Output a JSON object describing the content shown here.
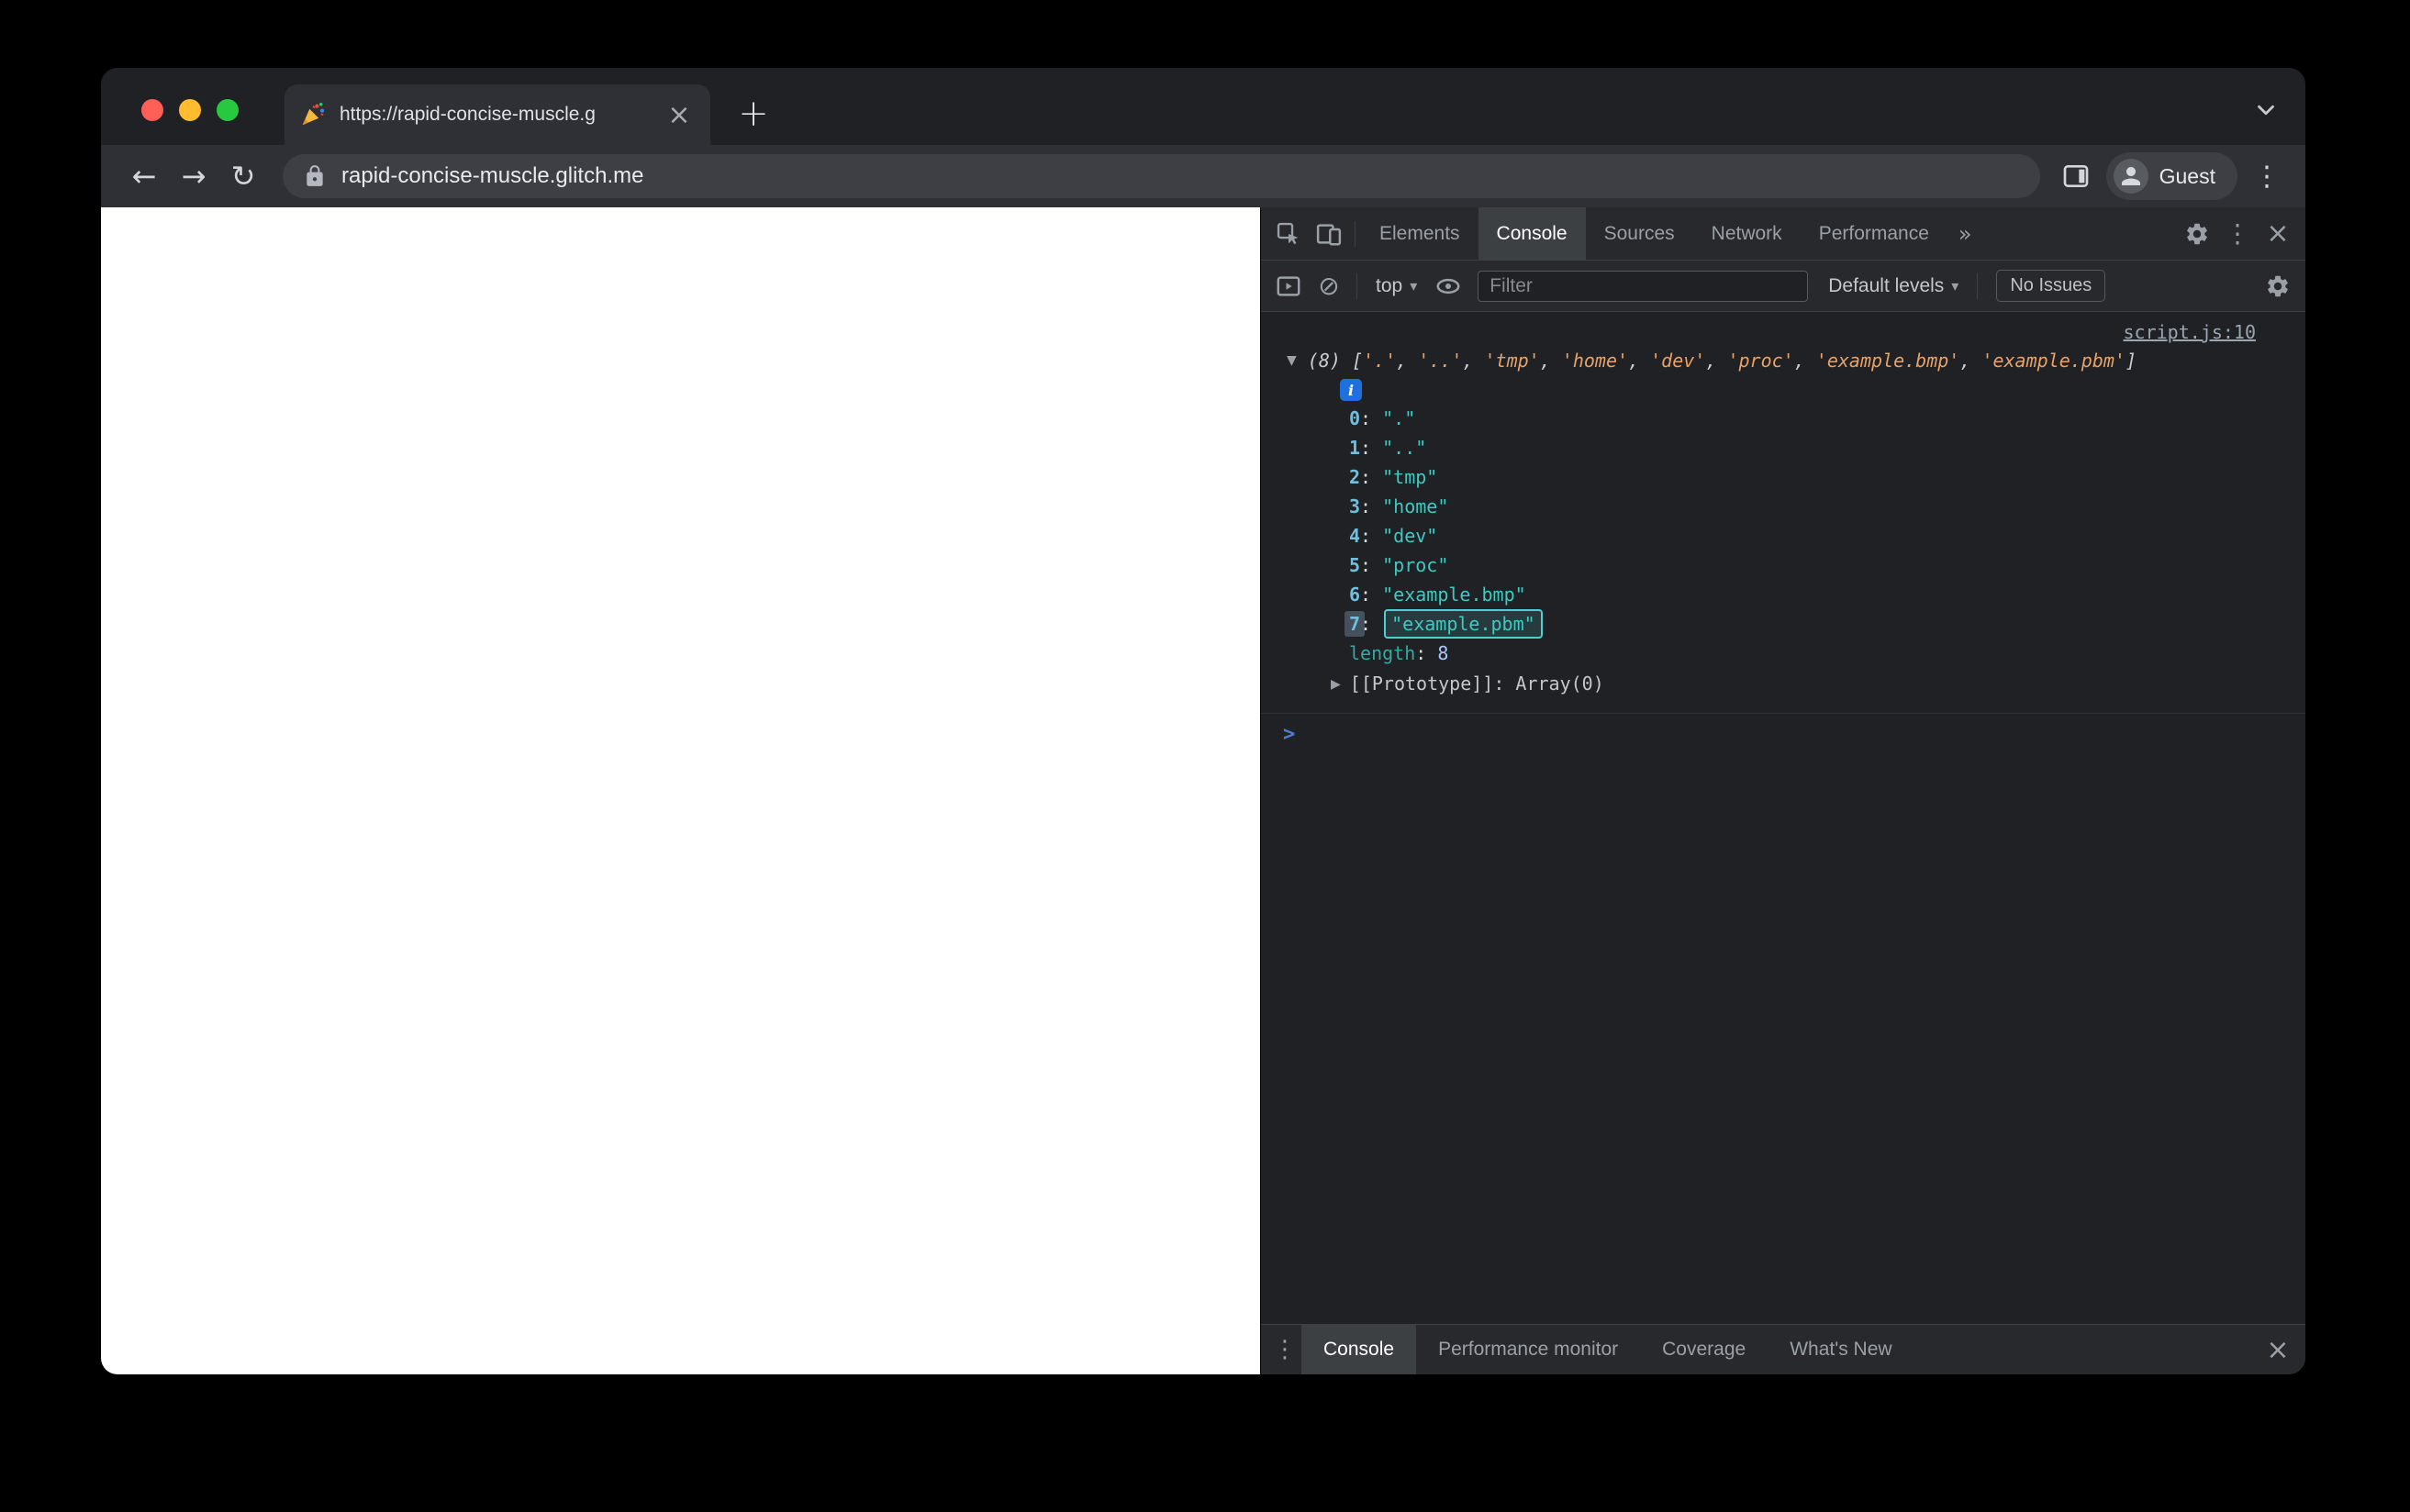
{
  "browser": {
    "tab": {
      "favicon": "party-popper",
      "title": "https://rapid-concise-muscle.g",
      "close_icon": "×"
    },
    "new_tab_icon": "+",
    "back_icon": "←",
    "forward_icon": "→",
    "reload_icon": "↻",
    "url": "rapid-concise-muscle.glitch.me",
    "profile_label": "Guest",
    "menu_icon": "⋮"
  },
  "devtools": {
    "tabs": [
      "Elements",
      "Console",
      "Sources",
      "Network",
      "Performance"
    ],
    "active_tab": "Console",
    "more_tabs_icon": "»",
    "menu_icon": "⋮",
    "close_icon": "×",
    "toolbar": {
      "clear_icon": "⊘",
      "context_label": "top",
      "caret_icon": "▾",
      "filter_placeholder": "Filter",
      "levels_label": "Default levels",
      "issues_label": "No Issues"
    },
    "console": {
      "source_link": "script.js:10",
      "expanded_icon": "▼",
      "collapsed_icon": "▶",
      "info_icon": "i",
      "prompt_icon": ">",
      "preview": {
        "count": "(8) ",
        "open": "[",
        "close": "]",
        "separator": ", ",
        "items": [
          "'.'",
          "'..'",
          "'tmp'",
          "'home'",
          "'dev'",
          "'proc'",
          "'example.bmp'",
          "'example.pbm'"
        ]
      },
      "entries": [
        {
          "key": "0",
          "sep": ": ",
          "value": "\".\""
        },
        {
          "key": "1",
          "sep": ": ",
          "value": "\"..\""
        },
        {
          "key": "2",
          "sep": ": ",
          "value": "\"tmp\""
        },
        {
          "key": "3",
          "sep": ": ",
          "value": "\"home\""
        },
        {
          "key": "4",
          "sep": ": ",
          "value": "\"dev\""
        },
        {
          "key": "5",
          "sep": ": ",
          "value": "\"proc\""
        },
        {
          "key": "6",
          "sep": ": ",
          "value": "\"example.bmp\""
        },
        {
          "key": "7",
          "sep": ": ",
          "value": "\"example.pbm\""
        }
      ],
      "length_row": {
        "key": "length",
        "sep": ": ",
        "value": "8"
      },
      "prototype_row": {
        "key": "[[Prototype]]",
        "sep": ": ",
        "value": "Array(0)"
      }
    },
    "drawer": {
      "menu_icon": "⋮",
      "tabs": [
        "Console",
        "Performance monitor",
        "Coverage",
        "What's New"
      ],
      "active_tab": "Console",
      "close_icon": "×"
    }
  },
  "colors": {
    "traffic_red": "#FF5F57",
    "traffic_yellow": "#FEBC2E",
    "traffic_green": "#28C840",
    "string_preview": "#E8A268",
    "string_value": "#3FC9C1",
    "index_key": "#6FC0E0",
    "selection_teal": "#4ECFD4",
    "prompt_blue": "#4D7FD0",
    "info_blue": "#1F6FDE"
  }
}
